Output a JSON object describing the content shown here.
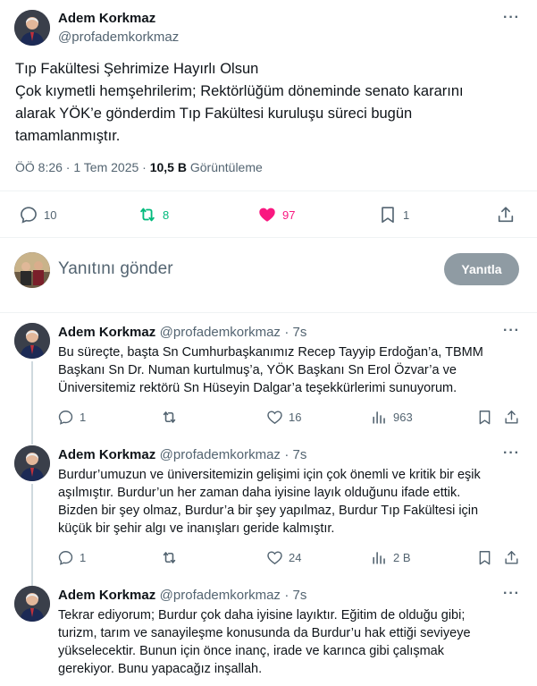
{
  "main_tweet": {
    "author_name": "Adem Korkmaz",
    "author_handle": "@profademkorkmaz",
    "more_icon": "ellipsis-icon",
    "lines": [
      "Tıp Fakültesi Şehrimize Hayırlı Olsun",
      "Çok kıymetli hemşehrilerim; Rektörlüğüm döneminde senato kararını",
      "alarak YÖK’e gönderdim Tıp Fakültesi kuruluşu süreci bugün",
      "tamamlanmıştır."
    ],
    "timestamp": "ÖÖ 8:26 · 1 Tem 2025 · ",
    "views_count": "10,5 B",
    "views_label": " Görüntüleme",
    "actions": {
      "replies": "10",
      "retweets": "8",
      "likes": "97",
      "bookmarks": "1"
    }
  },
  "compose": {
    "placeholder": "Yanıtını gönder",
    "button_label": "Yanıtla"
  },
  "replies": [
    {
      "author_name": "Adem Korkmaz",
      "author_handle": "@profademkorkmaz",
      "time": "· 7s",
      "lines": [
        "Bu süreçte, başta Sn Cumhurbaşkanımız Recep Tayyip Erdoğan’a,  TBMM",
        "Başkanı Sn Dr. Numan kurtulmuş’a, YÖK Başkanı Sn Erol Özvar’a ve",
        "Üniversitemiz rektörü Sn  Hüseyin Dalgar’a teşekkürlerimi sunuyorum."
      ],
      "replies": "1",
      "retweets": "",
      "likes": "16",
      "views": "963"
    },
    {
      "author_name": "Adem Korkmaz",
      "author_handle": "@profademkorkmaz",
      "time": "· 7s",
      "lines": [
        "Burdur’umuzun ve üniversitemizin gelişimi için çok önemli ve kritik bir eşik",
        "aşılmıştır. Burdur’un her zaman daha iyisine layık olduğunu ifade ettik.",
        "Bizden bir şey olmaz, Burdur’a bir şey yapılmaz, Burdur Tıp Fakültesi için",
        "küçük bir şehir algı ve inanışları geride kalmıştır."
      ],
      "replies": "1",
      "retweets": "",
      "likes": "24",
      "views": "2 B"
    },
    {
      "author_name": "Adem Korkmaz",
      "author_handle": "@profademkorkmaz",
      "time": "· 7s",
      "lines": [
        "Tekrar ediyorum; Burdur çok daha iyisine layıktır. Eğitim de olduğu gibi;",
        "turizm, tarım ve sanayileşme konusunda da Burdur’u hak ettiği seviyeye",
        "yükselecektir. Bunun için önce inanç, irade ve karınca gibi çalışmak",
        "gerekiyor. Bunu yapacağız inşallah."
      ]
    }
  ],
  "colors": {
    "retweet": "#00ba7c",
    "like": "#f91880",
    "muted": "#536471",
    "button": "#8f9ba3"
  }
}
